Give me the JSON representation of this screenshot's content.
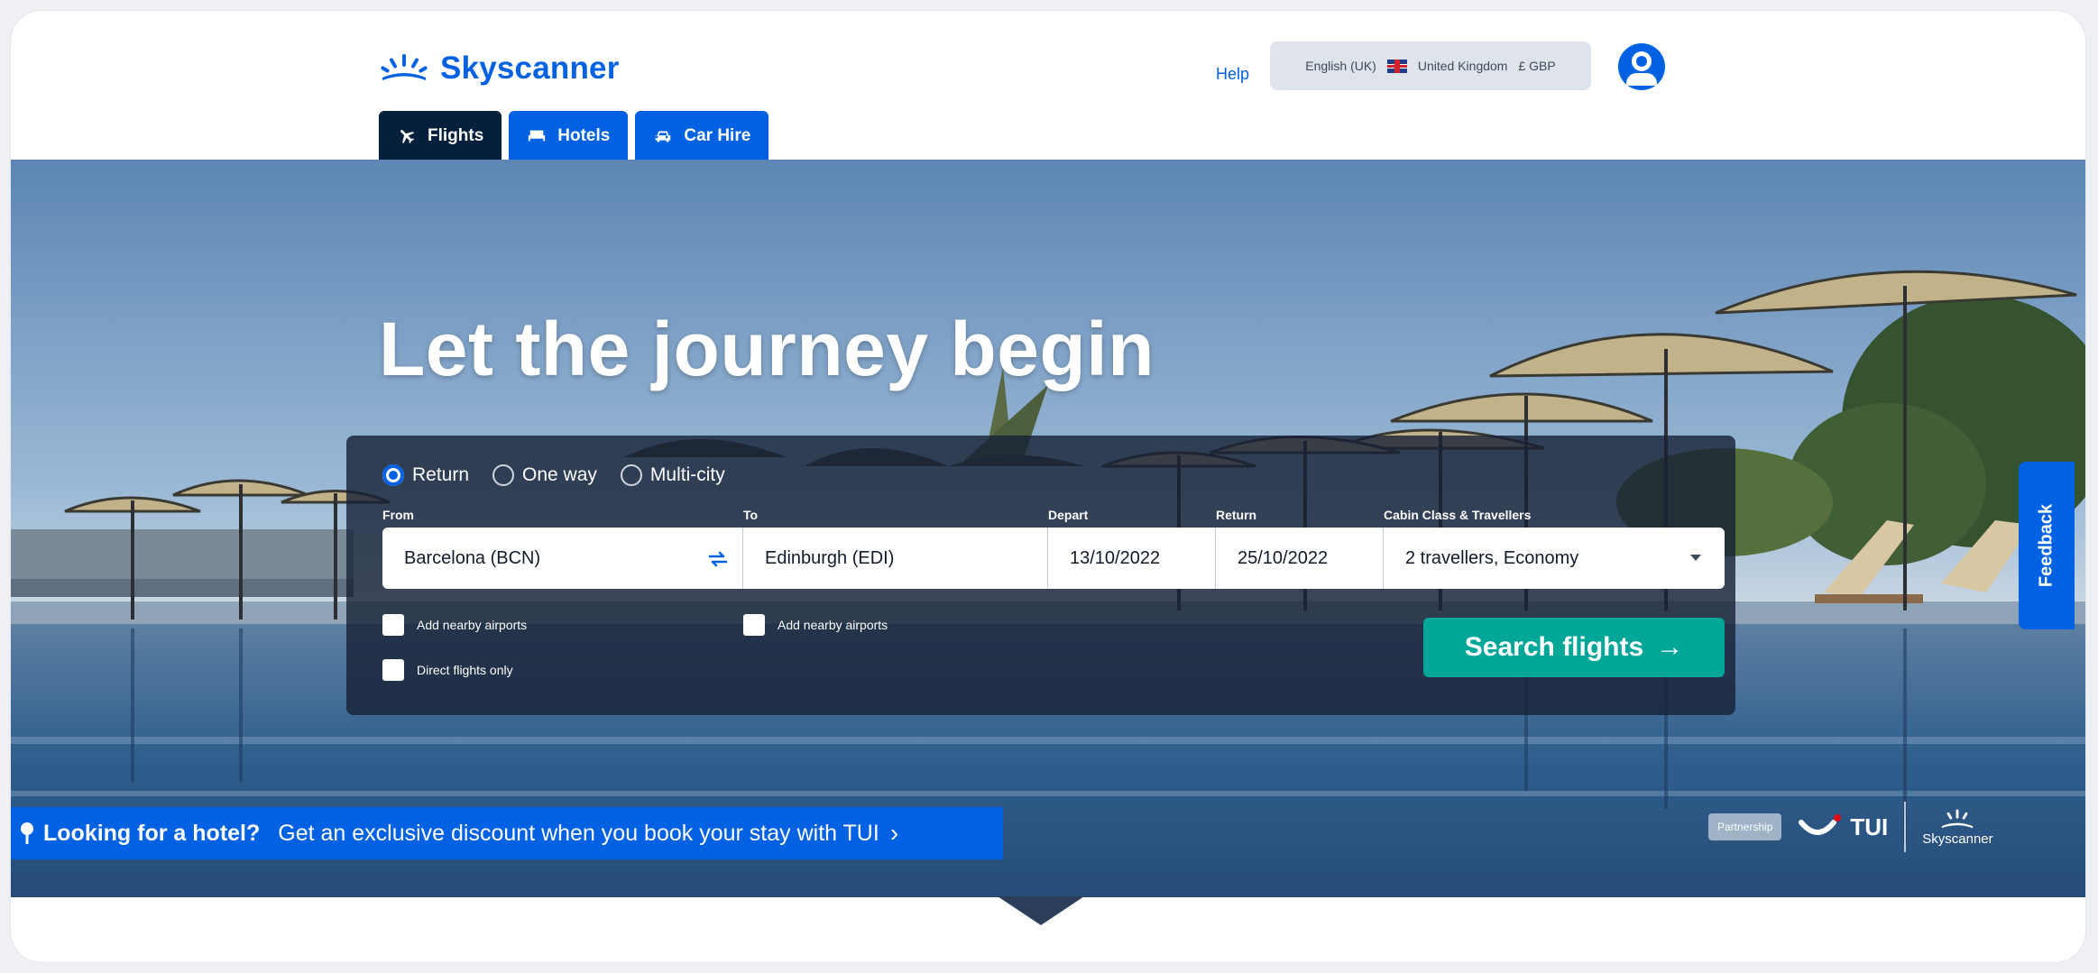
{
  "header": {
    "brand": "Skyscanner",
    "help_label": "Help",
    "locale": {
      "language": "English (UK)",
      "country": "United Kingdom",
      "currency": "£ GBP"
    }
  },
  "tabs": [
    {
      "label": "Flights",
      "icon": "plane-icon",
      "active": true
    },
    {
      "label": "Hotels",
      "icon": "bed-icon",
      "active": false
    },
    {
      "label": "Car Hire",
      "icon": "car-icon",
      "active": false
    }
  ],
  "hero": {
    "headline": "Let the journey begin"
  },
  "search": {
    "trip_types": [
      {
        "label": "Return",
        "selected": true
      },
      {
        "label": "One way",
        "selected": false
      },
      {
        "label": "Multi-city",
        "selected": false
      }
    ],
    "labels": {
      "from": "From",
      "to": "To",
      "depart": "Depart",
      "return": "Return",
      "cabin": "Cabin Class & Travellers"
    },
    "values": {
      "from": "Barcelona (BCN)",
      "to": "Edinburgh (EDI)",
      "depart": "13/10/2022",
      "return": "25/10/2022",
      "cabin": "2 travellers, Economy"
    },
    "options": {
      "nearby_from": "Add nearby airports",
      "nearby_to": "Add nearby airports",
      "direct": "Direct flights only"
    },
    "button": "Search flights",
    "button_arrow": "→"
  },
  "promo": {
    "bold": "Looking for a hotel?",
    "text": "Get an exclusive discount when you book your stay with TUI",
    "chevron": "›"
  },
  "partner": {
    "badge": "Partnership",
    "tui": "TUI",
    "skyscanner": "Skyscanner"
  },
  "feedback": {
    "label": "Feedback"
  },
  "colors": {
    "brand": "#0062e3",
    "dark": "#05203c",
    "cta": "#00a698"
  }
}
